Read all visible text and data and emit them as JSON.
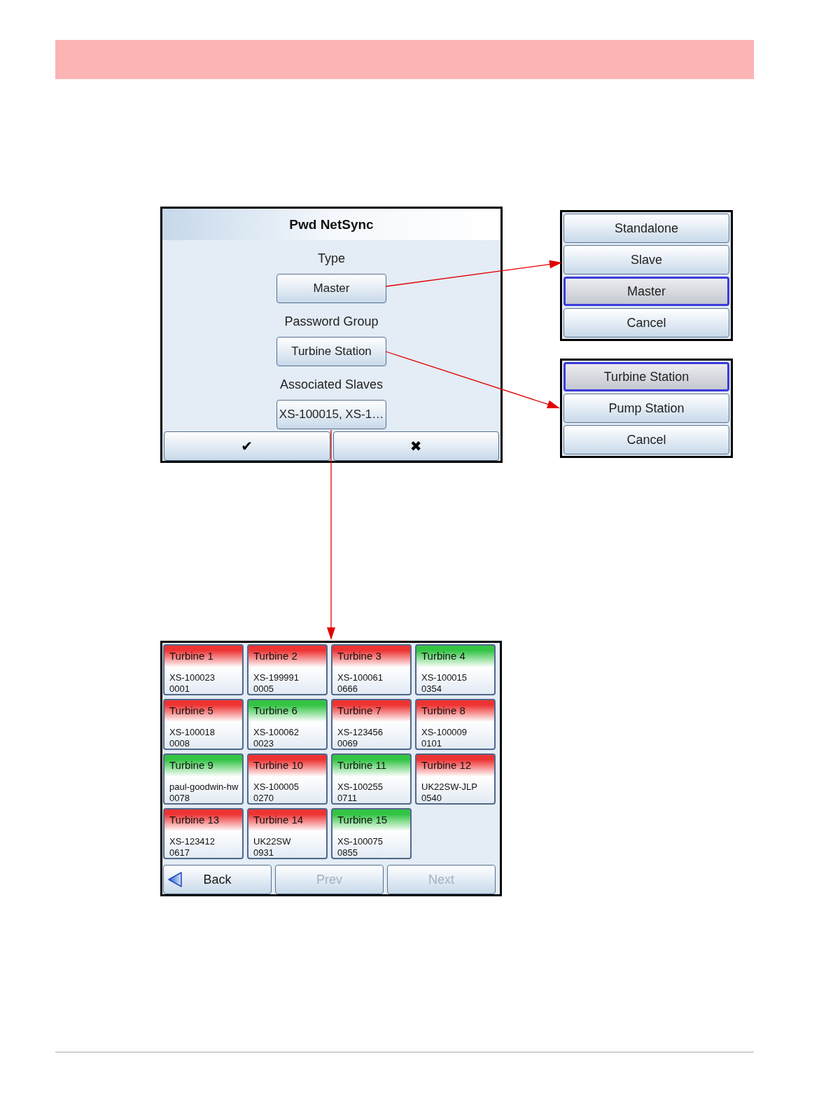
{
  "dialog": {
    "title": "Pwd NetSync",
    "fields": [
      {
        "label": "Type",
        "value": "Master"
      },
      {
        "label": "Password Group",
        "value": "Turbine Station"
      },
      {
        "label": "Associated Slaves",
        "value": "XS-100015, XS-1…"
      }
    ],
    "actions": [
      "✔",
      "✖"
    ]
  },
  "type_menu": {
    "options": [
      {
        "label": "Standalone",
        "selected": false
      },
      {
        "label": "Slave",
        "selected": false
      },
      {
        "label": "Master",
        "selected": true
      },
      {
        "label": "Cancel",
        "selected": false
      }
    ]
  },
  "group_menu": {
    "options": [
      {
        "label": "Turbine Station",
        "selected": true
      },
      {
        "label": "Pump Station",
        "selected": false
      },
      {
        "label": "Cancel",
        "selected": false
      }
    ]
  },
  "turbine_grid": {
    "tiles": [
      {
        "name": "Turbine 1",
        "device": "XS-100023",
        "number": "0001",
        "color": "#ee3333"
      },
      {
        "name": "Turbine 2",
        "device": "XS-199991",
        "number": "0005",
        "color": "#ee3333"
      },
      {
        "name": "Turbine 3",
        "device": "XS-100061",
        "number": "0666",
        "color": "#ee3333"
      },
      {
        "name": "Turbine 4",
        "device": "XS-100015",
        "number": "0354",
        "color": "#33c444"
      },
      {
        "name": "Turbine 5",
        "device": "XS-100018",
        "number": "0008",
        "color": "#ee3333"
      },
      {
        "name": "Turbine 6",
        "device": "XS-100062",
        "number": "0023",
        "color": "#33c444"
      },
      {
        "name": "Turbine 7",
        "device": "XS-123456",
        "number": "0069",
        "color": "#ee3333"
      },
      {
        "name": "Turbine 8",
        "device": "XS-100009",
        "number": "0101",
        "color": "#ee3333"
      },
      {
        "name": "Turbine 9",
        "device": "paul-goodwin-hw",
        "number": "0078",
        "color": "#33c444"
      },
      {
        "name": "Turbine 10",
        "device": "XS-100005",
        "number": "0270",
        "color": "#ee3333"
      },
      {
        "name": "Turbine 11",
        "device": "XS-100255",
        "number": "0711",
        "color": "#33c444"
      },
      {
        "name": "Turbine 12",
        "device": "UK22SW-JLP",
        "number": "0540",
        "color": "#ee3333"
      },
      {
        "name": "Turbine 13",
        "device": "XS-123412",
        "number": "0617",
        "color": "#ee3333"
      },
      {
        "name": "Turbine 14",
        "device": "UK22SW",
        "number": "0931",
        "color": "#ee3333"
      },
      {
        "name": "Turbine 15",
        "device": "XS-100075",
        "number": "0855",
        "color": "#33c444"
      }
    ],
    "nav_buttons": [
      {
        "label": "Back",
        "kind": "back",
        "disabled": false
      },
      {
        "label": "Prev",
        "kind": "page",
        "disabled": true
      },
      {
        "label": "Next",
        "kind": "page",
        "disabled": true
      }
    ]
  }
}
